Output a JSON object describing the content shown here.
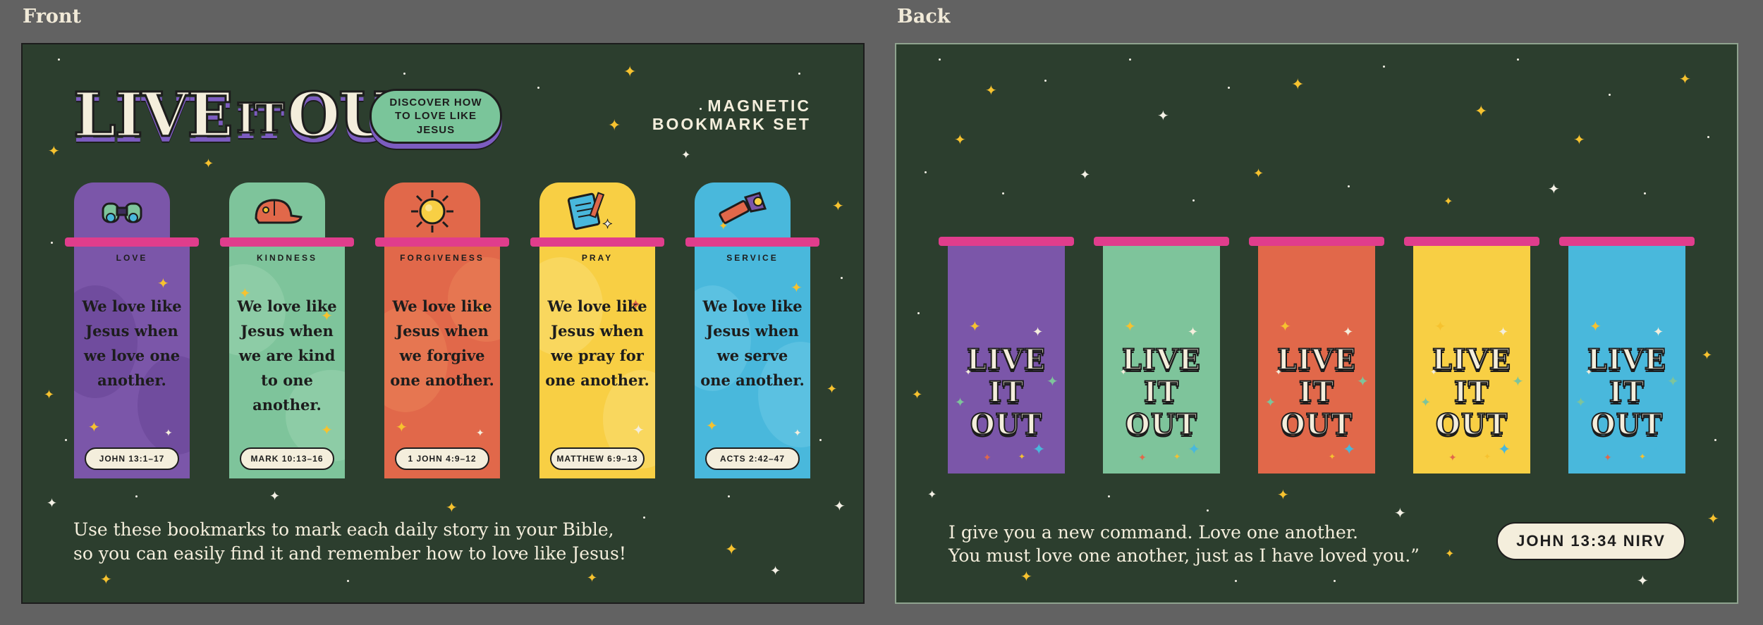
{
  "panels": {
    "front_label": "Front",
    "back_label": "Back"
  },
  "front": {
    "logo": {
      "word1": "LIVE",
      "word2": "IT",
      "word3": "OUT"
    },
    "discover_pill": "DISCOVER HOW TO LOVE LIKE JESUS",
    "set_title_line1": "MAGNETIC",
    "set_title_line2": "BOOKMARK SET",
    "bookmarks": [
      {
        "theme": "LOVE",
        "quote": "We love like Jesus when we love one another.",
        "reference": "JOHN 13:1–17",
        "icon": "binoculars-icon",
        "color": "#7b56a9"
      },
      {
        "theme": "KINDNESS",
        "quote": "We love like Jesus when we are kind to one another.",
        "reference": "MARK 10:13–16",
        "icon": "cap-icon",
        "color": "#7ec49b"
      },
      {
        "theme": "FORGIVENESS",
        "quote": "We love like Jesus when we forgive one another.",
        "reference": "1 JOHN 4:9–12",
        "icon": "sun-icon",
        "color": "#e1684a"
      },
      {
        "theme": "PRAY",
        "quote": "We love like Jesus when we pray for one another.",
        "reference": "MATTHEW 6:9–13",
        "icon": "notepad-icon",
        "color": "#f8cf44"
      },
      {
        "theme": "SERVICE",
        "quote": "We love like Jesus when we serve one another.",
        "reference": "ACTS 2:42–47",
        "icon": "flashlight-icon",
        "color": "#49b8dc"
      }
    ],
    "caption_line1": "Use these bookmarks to mark each daily story in your Bible,",
    "caption_line2": "so you can easily find it and remember how to love like Jesus!"
  },
  "back": {
    "bookmark_logo": {
      "line1": "LIVE",
      "line2": "IT",
      "line3": "OUT"
    },
    "bookmark_colors": [
      "#7b56a9",
      "#7ec49b",
      "#e1684a",
      "#f8cf44",
      "#49b8dc"
    ],
    "caption_line1": "I give you a new command. Love one another.",
    "caption_line2": "You must love one another, just as I have loved you.”",
    "verse_reference": "JOHN 13:34 NIRV"
  },
  "colors": {
    "background": "#2c3e2e",
    "canvas": "#626262",
    "magnet": "#e03d8c",
    "cream": "#f4eedc",
    "star_yellow": "#f6c22f"
  }
}
